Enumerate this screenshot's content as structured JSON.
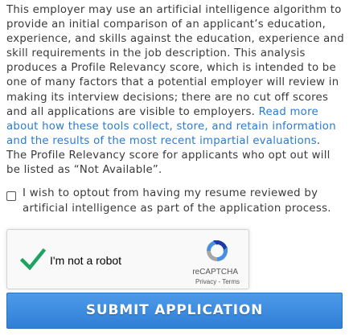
{
  "disclaimer": {
    "text_before": "This employer may use an artificial intelligence algorithm to provide an initial comparison of an applicant’s education, experience, and skills against the education, experience and skill requirements in the job description. This analysis produces a Profile Relevancy score, which is intended to be one of many factors that a potential employer will review in making its interview decisions; there are no cut off scores and all applications are visible to employers. ",
    "link_text": "Read more about how these tools collect, store, and retain information and the results of the most recent impartial evaluations",
    "text_after": ". The Profile Relevancy score for applicants who opt out will be listed as “Not Available”."
  },
  "optout": {
    "label": "I wish to optout from having my resume reviewed by artificial intelligence as part of the application process.",
    "checked": false
  },
  "captcha": {
    "label": "I'm not a robot",
    "brand": "reCAPTCHA",
    "privacy": "Privacy",
    "separator": " - ",
    "terms": "Terms",
    "checkmark_color": "#1ea362"
  },
  "submit": {
    "label": "SUBMIT APPLICATION",
    "color": "#3b8ae0"
  }
}
